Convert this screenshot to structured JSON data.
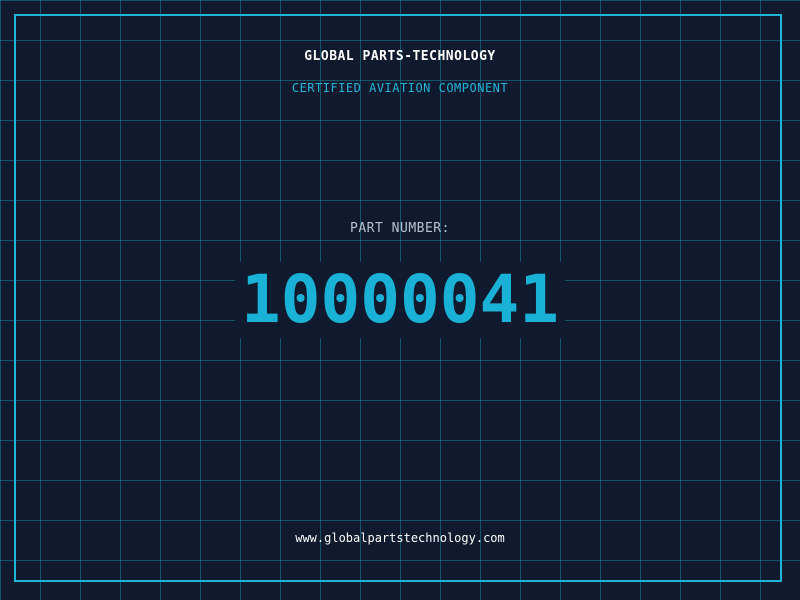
{
  "header": {
    "company": "GLOBAL PARTS-TECHNOLOGY",
    "tagline": "CERTIFIED AVIATION COMPONENT"
  },
  "part": {
    "label": "PART NUMBER:",
    "number": "10000041"
  },
  "footer": {
    "website": "www.globalpartstechnology.com"
  },
  "colors": {
    "background": "#0f1a2e",
    "accent": "#1fb4d8",
    "grid": "#1a96b4",
    "text": "#ffffff",
    "label": "#b8c2cc"
  }
}
